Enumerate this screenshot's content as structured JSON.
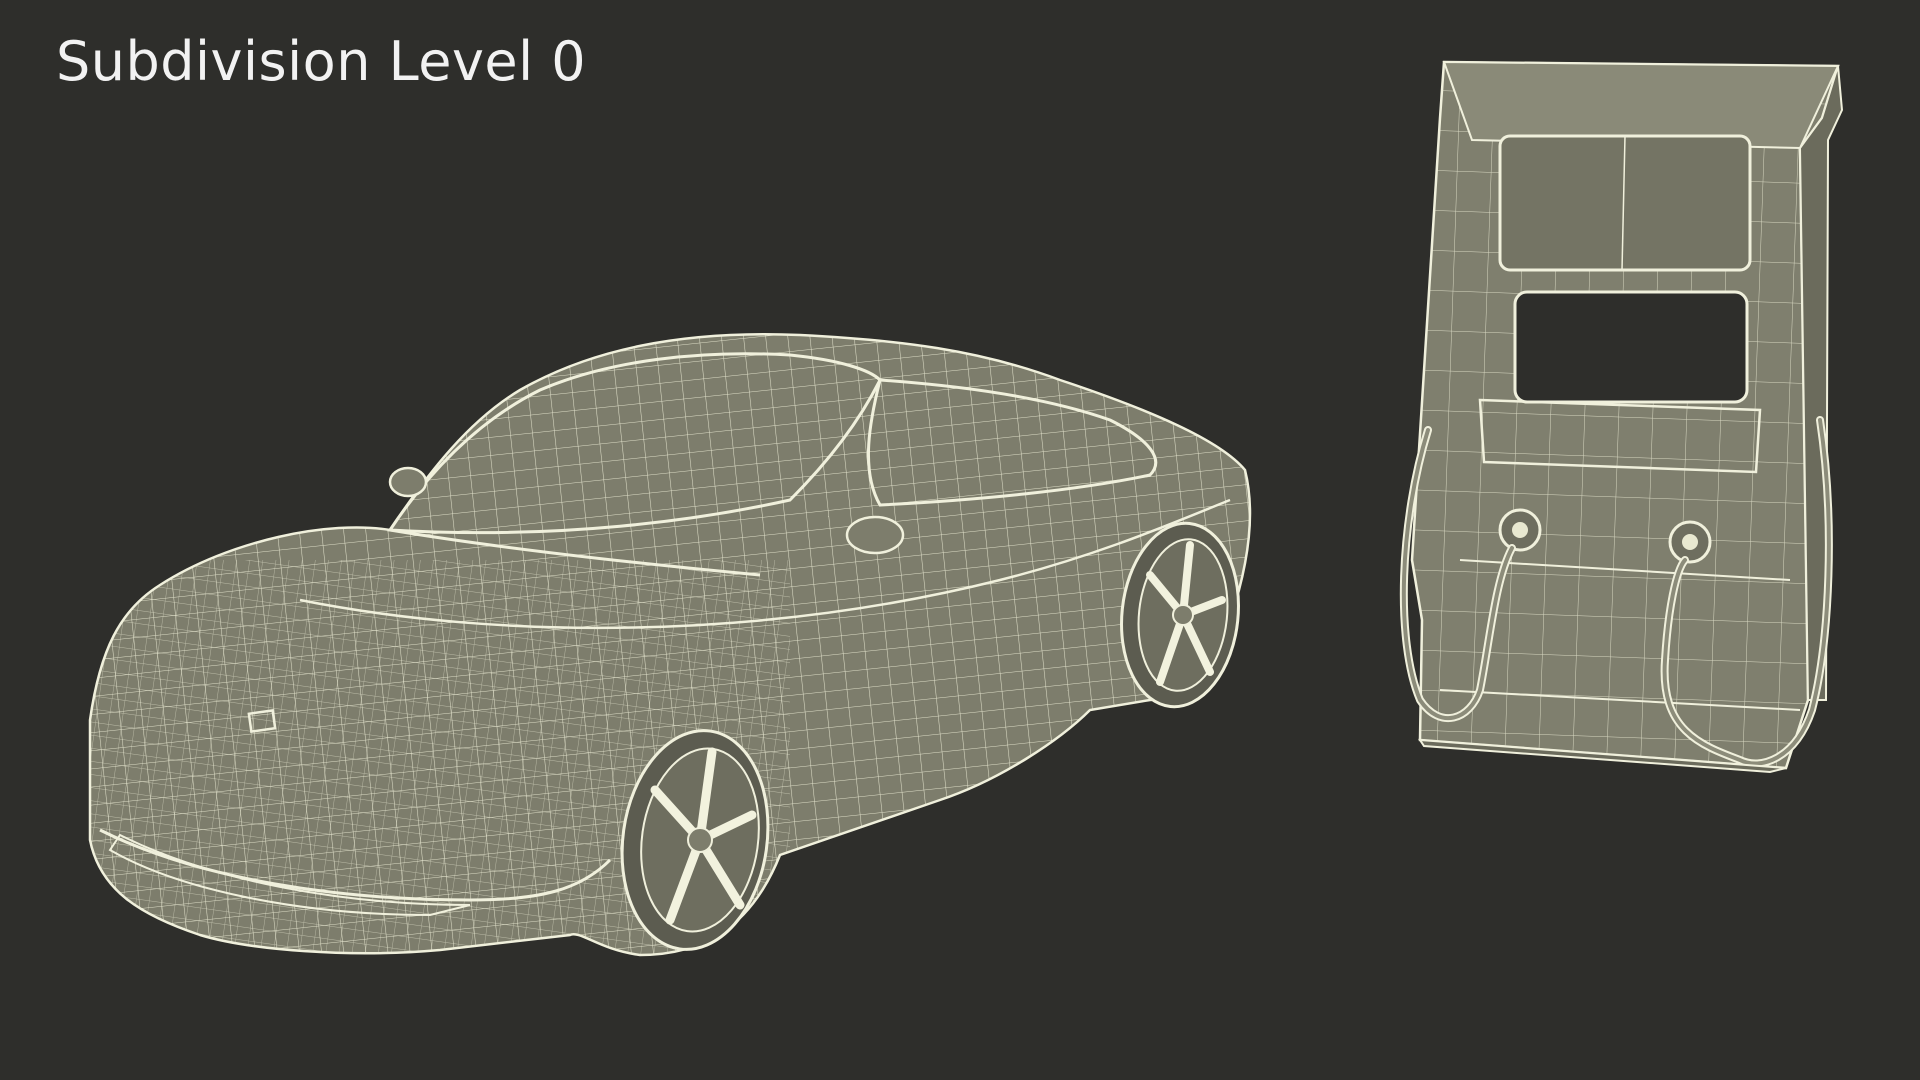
{
  "title": "Subdivision Level 0",
  "colors": {
    "background": "#2e2e2b",
    "surface": "#7d7d6c",
    "wire": "#f0f0dc",
    "wire_dark": "#d8d8c0",
    "title_text": "#f2f2f2"
  },
  "objects": [
    {
      "name": "sports-car-wireframe"
    },
    {
      "name": "ev-charging-station-wireframe"
    }
  ]
}
